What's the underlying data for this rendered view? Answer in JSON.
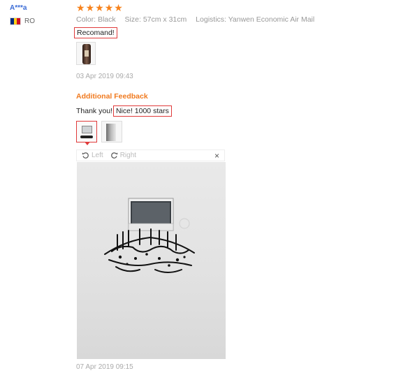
{
  "user": {
    "name": "A***a",
    "country": "RO",
    "flag_colors": [
      "#002b7f",
      "#fcd116",
      "#ce1126"
    ]
  },
  "rating": {
    "stars": 5,
    "star_color": "#f7821b"
  },
  "attributes": [
    {
      "key": "Color:",
      "value": "Black"
    },
    {
      "key": "Size:",
      "value": "57cm x 31cm"
    },
    {
      "key": "Logistics:",
      "value": "Yanwen Economic Air Mail"
    }
  ],
  "review": {
    "text": "Recomand!",
    "date": "03 Apr 2019 09:43"
  },
  "additional": {
    "title": "Additional Feedback",
    "prefix": "Thank you!",
    "highlight": "Nice! 1000 stars",
    "date": "07 Apr 2019 09:15"
  },
  "viewer": {
    "left_label": "Left",
    "right_label": "Right",
    "close": "×"
  },
  "colors": {
    "accent": "#f07a1f",
    "highlight_border": "#e03a3a",
    "link": "#3a6bd6"
  }
}
